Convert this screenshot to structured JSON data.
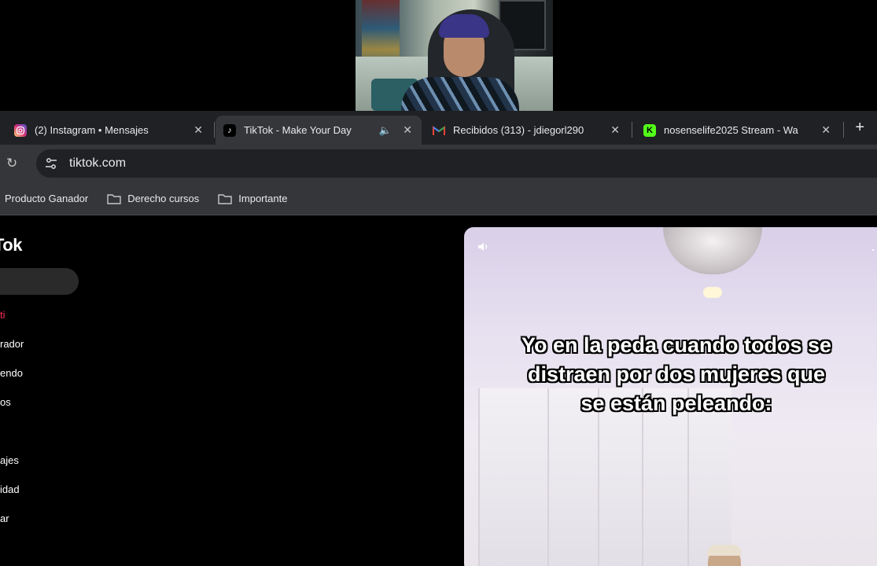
{
  "tabs": [
    {
      "title": "(2) Instagram • Mensajes",
      "favicon": "instagram-icon",
      "active": false
    },
    {
      "title": "TikTok - Make Your Day",
      "favicon": "tiktok-icon",
      "active": true,
      "audio": true
    },
    {
      "title": "Recibidos (313) - jdiegorl290",
      "favicon": "gmail-icon",
      "active": false
    },
    {
      "title": "nosenselife2025 Stream - Wa",
      "favicon": "kick-icon",
      "active": false
    }
  ],
  "new_tab": "+",
  "address_bar": {
    "url": "tiktok.com"
  },
  "bookmarks": [
    {
      "label": "Producto Ganador",
      "icon": ""
    },
    {
      "label": "Derecho cursos",
      "icon": "folder-icon"
    },
    {
      "label": "Importante",
      "icon": "folder-icon"
    }
  ],
  "tiktok": {
    "logo": "Tok",
    "nav": [
      {
        "label": "ti",
        "active": true
      },
      {
        "label": "rador",
        "active": false
      },
      {
        "label": "endo",
        "active": false
      },
      {
        "label": "os",
        "active": false
      },
      {
        "label": "ajes",
        "active": false
      },
      {
        "label": "idad",
        "active": false
      },
      {
        "label": "ar",
        "active": false
      }
    ],
    "video_caption": "Yo en la peda cuando todos se distraen por dos mujeres que se están peleando:",
    "more": "···"
  },
  "colors": {
    "accent": "#fe2c55",
    "tabstrip": "#202124",
    "toolbar": "#35363a"
  }
}
